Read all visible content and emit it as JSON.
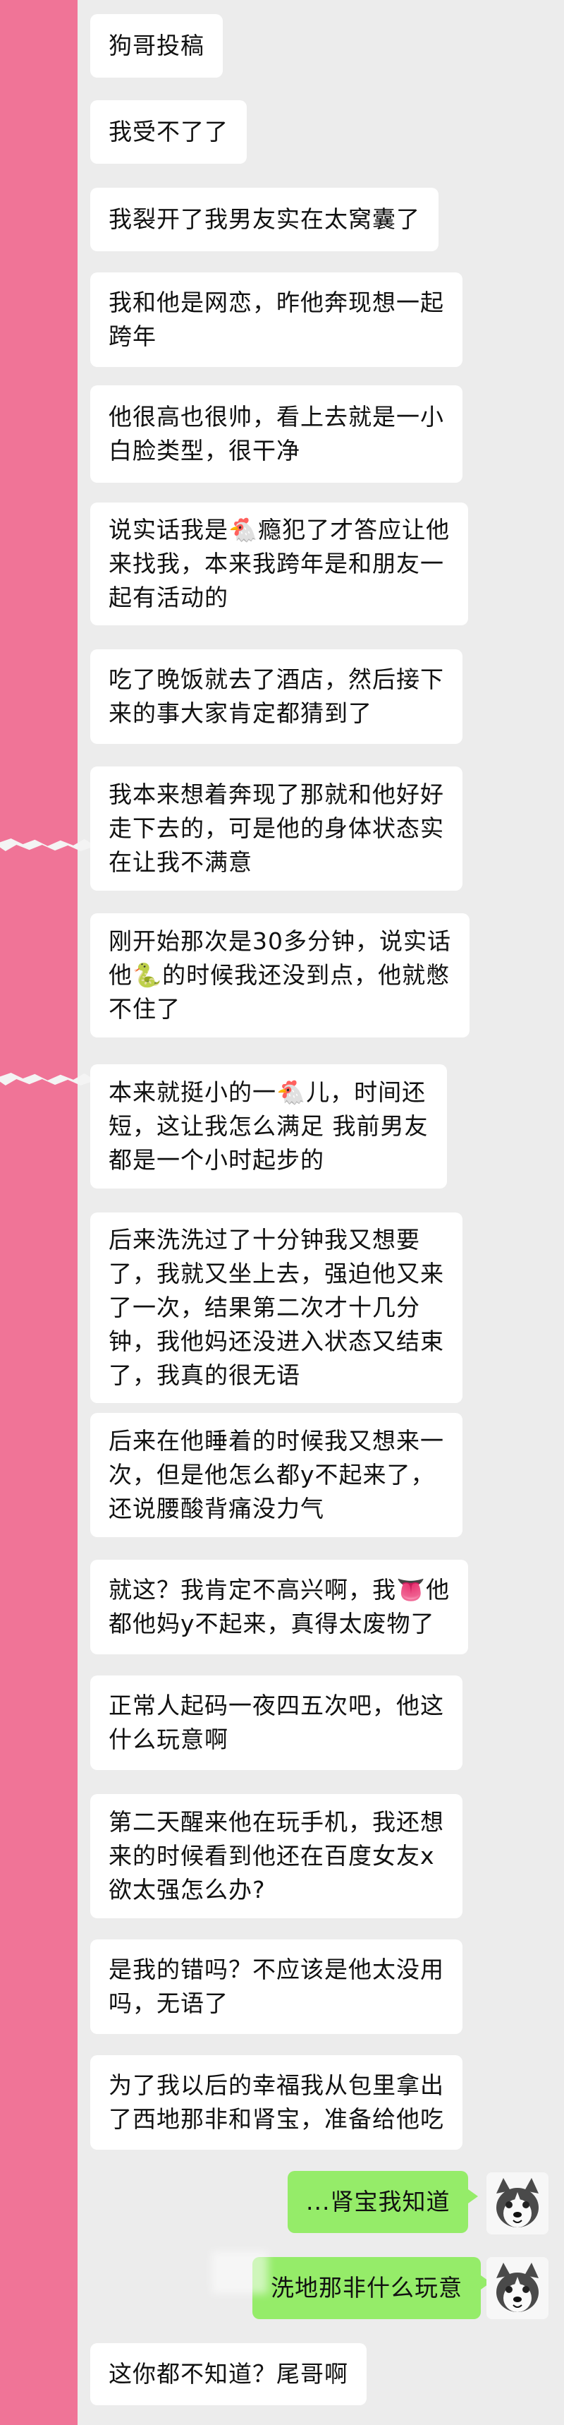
{
  "messages": [
    {
      "side": "left",
      "text": "狗哥投稿"
    },
    {
      "side": "left",
      "text": "我受不了了"
    },
    {
      "side": "left",
      "text": "我裂开了我男友实在太窝囊了"
    },
    {
      "side": "left",
      "text": "我和他是网恋，昨他奔现想一起\n跨年"
    },
    {
      "side": "left",
      "text": "他很高也很帅，看上去就是一小\n白脸类型，很干净"
    },
    {
      "side": "left",
      "text": "说实话我是🐔瘾犯了才答应让他\n来找我，本来我跨年是和朋友一\n起有活动的"
    },
    {
      "side": "left",
      "text": "吃了晚饭就去了酒店，然后接下\n来的事大家肯定都猜到了"
    },
    {
      "side": "left",
      "text": "我本来想着奔现了那就和他好好\n走下去的，可是他的身体状态实\n在让我不满意"
    },
    {
      "side": "left",
      "text": "刚开始那次是30多分钟，说实话\n他🐍的时候我还没到点，他就憋\n不住了"
    },
    {
      "side": "left",
      "text": "本来就挺小的一🐔儿，时间还\n短，这让我怎么满足 我前男友\n都是一个小时起步的"
    },
    {
      "side": "left",
      "text": "后来洗洗过了十分钟我又想要\n了，我就又坐上去，强迫他又来\n了一次，结果第二次才十几分\n钟，我他妈还没进入状态又结束\n了，我真的很无语"
    },
    {
      "side": "left",
      "text": "后来在他睡着的时候我又想来一\n次，但是他怎么都y不起来了，\n还说腰酸背痛没力气"
    },
    {
      "side": "left",
      "text": "就这？我肯定不高兴啊，我👅他\n都他妈y不起来，真得太废物了"
    },
    {
      "side": "left",
      "text": "正常人起码一夜四五次吧，他这\n什么玩意啊"
    },
    {
      "side": "left",
      "text": "第二天醒来他在玩手机，我还想\n来的时候看到他还在百度女友x\n欲太强怎么办?"
    },
    {
      "side": "left",
      "text": "是我的错吗？不应该是他太没用\n吗，无语了"
    },
    {
      "side": "left",
      "text": "为了我以后的幸福我从包里拿出\n了西地那非和肾宝，准备给他吃"
    },
    {
      "side": "right",
      "text": "...肾宝我知道"
    },
    {
      "side": "right",
      "text": "洗地那非什么玩意"
    },
    {
      "side": "left",
      "text": "这你都不知道？尾哥啊"
    }
  ],
  "icons": {
    "avatar": "husky-avatar-icon"
  },
  "colors": {
    "background": "#ececec",
    "left_bubble": "#ffffff",
    "right_bubble": "#95ec69",
    "side_bar": "#f07497"
  }
}
